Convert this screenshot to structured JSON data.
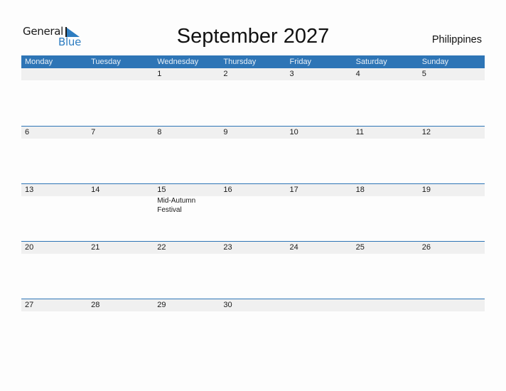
{
  "logo": {
    "line1": "General",
    "line2": "Blue",
    "brand_color": "#2e7dc1"
  },
  "title": "September 2027",
  "country": "Philippines",
  "colors": {
    "header_bg": "#2e75b6",
    "date_stripe": "#f0f0f0",
    "week_border": "#2e75b6"
  },
  "weekdays": [
    "Monday",
    "Tuesday",
    "Wednesday",
    "Thursday",
    "Friday",
    "Saturday",
    "Sunday"
  ],
  "weeks": [
    [
      {
        "day": ""
      },
      {
        "day": ""
      },
      {
        "day": "1"
      },
      {
        "day": "2"
      },
      {
        "day": "3"
      },
      {
        "day": "4"
      },
      {
        "day": "5"
      }
    ],
    [
      {
        "day": "6"
      },
      {
        "day": "7"
      },
      {
        "day": "8"
      },
      {
        "day": "9"
      },
      {
        "day": "10"
      },
      {
        "day": "11"
      },
      {
        "day": "12"
      }
    ],
    [
      {
        "day": "13"
      },
      {
        "day": "14"
      },
      {
        "day": "15",
        "event": "Mid-Autumn Festival"
      },
      {
        "day": "16"
      },
      {
        "day": "17"
      },
      {
        "day": "18"
      },
      {
        "day": "19"
      }
    ],
    [
      {
        "day": "20"
      },
      {
        "day": "21"
      },
      {
        "day": "22"
      },
      {
        "day": "23"
      },
      {
        "day": "24"
      },
      {
        "day": "25"
      },
      {
        "day": "26"
      }
    ],
    [
      {
        "day": "27"
      },
      {
        "day": "28"
      },
      {
        "day": "29"
      },
      {
        "day": "30"
      },
      {
        "day": ""
      },
      {
        "day": ""
      },
      {
        "day": ""
      }
    ]
  ]
}
